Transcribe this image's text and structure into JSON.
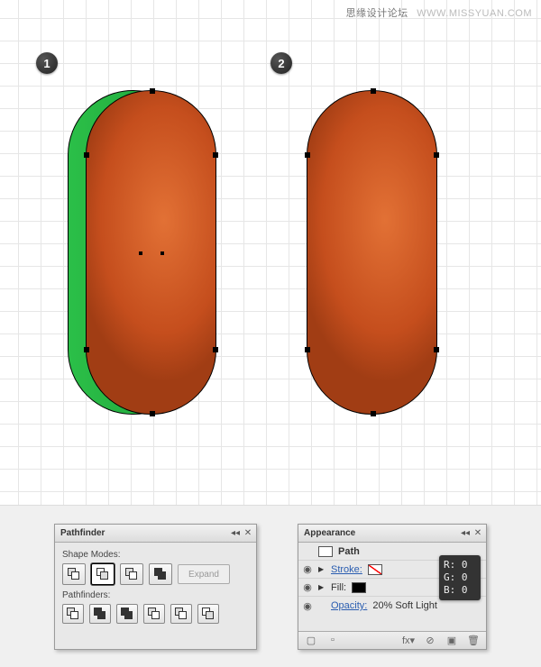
{
  "watermark": {
    "cn": "思缘设计论坛",
    "url": "WWW.MISSYUAN.COM"
  },
  "steps": {
    "one": "1",
    "two": "2"
  },
  "pathfinder": {
    "title": "Pathfinder",
    "shape_modes_label": "Shape Modes:",
    "pathfinders_label": "Pathfinders:",
    "expand": "Expand",
    "menu_collapse": "◂◂",
    "menu_close": "✕"
  },
  "appearance": {
    "title": "Appearance",
    "menu_collapse": "◂◂",
    "menu_close": "✕",
    "path_label": "Path",
    "stroke_label": "Stroke:",
    "fill_label": "Fill:",
    "opacity_label": "Opacity:",
    "opacity_value": "20% Soft Light",
    "footer": {
      "new": "▢",
      "fx": "fx▾",
      "clear": "⊘",
      "dup": "▣",
      "trash": "🗑"
    }
  },
  "rgb": {
    "r": "R: 0",
    "g": "G: 0",
    "b": "B: 0"
  }
}
